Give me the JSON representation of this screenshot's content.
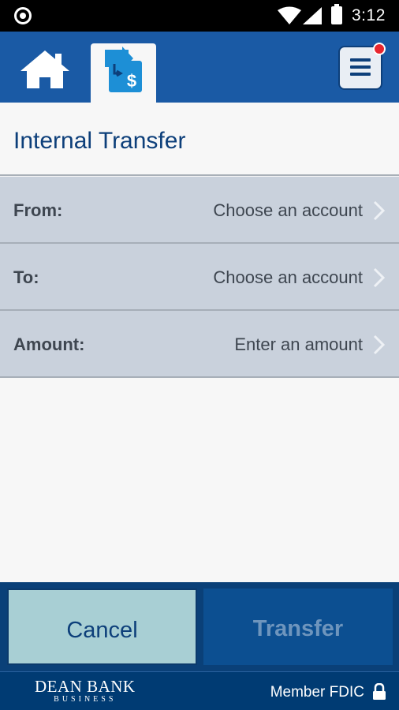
{
  "status_bar": {
    "time": "3:12",
    "icons": [
      "record-icon",
      "wifi-icon",
      "cell-signal-icon",
      "battery-icon"
    ]
  },
  "header": {
    "icons": [
      "home-icon",
      "transfer-dollar-icon",
      "menu-icon",
      "notification-dot"
    ],
    "active_tab": "transfer"
  },
  "page": {
    "title": "Internal Transfer"
  },
  "form": {
    "rows": [
      {
        "label": "From:",
        "value": "Choose an account"
      },
      {
        "label": "To:",
        "value": "Choose an account"
      },
      {
        "label": "Amount:",
        "value": "Enter an amount"
      }
    ]
  },
  "actions": {
    "cancel_label": "Cancel",
    "transfer_label": "Transfer"
  },
  "footer": {
    "brand_name": "DEAN BANK",
    "brand_sub": "BUSINESS",
    "fdic_text": "Member FDIC"
  },
  "colors": {
    "header_blue": "#1a5aa5",
    "title_blue": "#0d3f7a",
    "row_bg": "#c9d1dc",
    "cancel_bg": "#a8cfd4",
    "footer_bg": "#003b73",
    "notification_red": "#e8262e"
  }
}
